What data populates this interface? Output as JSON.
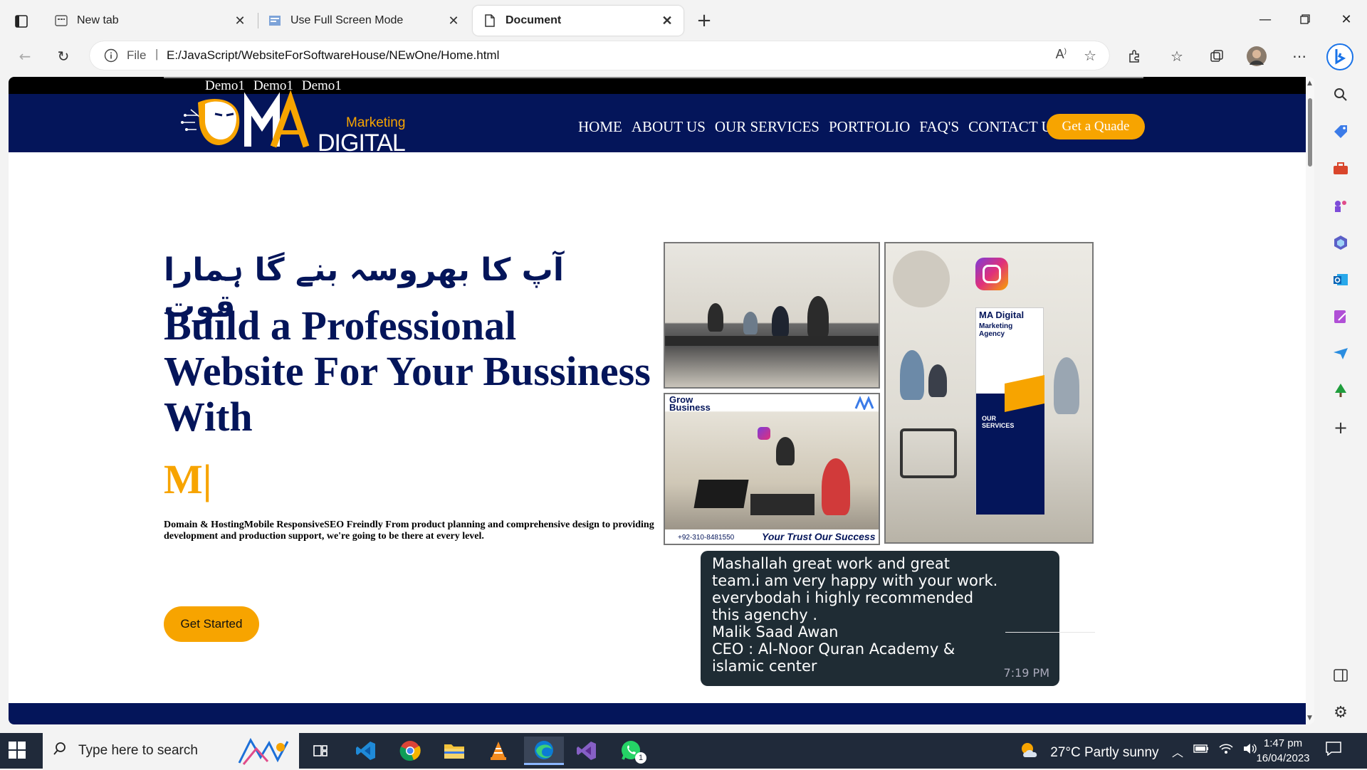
{
  "browser": {
    "tabs": [
      {
        "label": "New tab",
        "icon": "new-tab-icon"
      },
      {
        "label": "Use Full Screen Mode",
        "icon": "page-thumbnail-icon"
      },
      {
        "label": "Document",
        "icon": "document-icon",
        "active": true
      }
    ],
    "address": {
      "scheme": "File",
      "url": "E:/JavaScript/WebsiteForSoftwareHouse/NEwOne/Home.html"
    }
  },
  "site": {
    "demo_links": [
      "Demo1",
      "Demo1",
      "Demo1"
    ],
    "logo": {
      "word_top": "Marketing",
      "word_bottom": "DIGITAL"
    },
    "nav": [
      "HOME",
      "ABOUT US",
      "OUR SERVICES",
      "PORTFOLIO",
      "FAQ'S",
      "CONTACT US"
    ],
    "quote_button": "Get a Quade",
    "hero": {
      "urdu": "آپ کا بھروسہ بنے گا ہمارا قوت",
      "title_line1": "Build a Professional",
      "title_line2": "Website For Your Bussiness",
      "title_line3": "With",
      "typed": "M|",
      "description": "Domain & HostingMobile ResponsiveSEO Freindly From product planning and comprehensive design to providing development and production support, we're going to be there at every level.",
      "cta": "Get Started"
    },
    "photos": {
      "p2_brand": "MA Digital",
      "p2_sub": "Marketing Agency",
      "p2_services": "OUR SERVICES",
      "p3_header": "Grow Business",
      "p3_phone": "+92-310-8481550",
      "p3_footer": "Your Trust Our Success"
    },
    "review": {
      "lines": [
        "Mashallah great work and great",
        "team.i am very happy with your work.",
        "everybodah i highly recommended",
        "this agenchy .",
        "Malik Saad Awan",
        "CEO : Al-Noor Quran Academy &",
        "islamic center"
      ],
      "time": "7:19 PM"
    }
  },
  "taskbar": {
    "search_placeholder": "Type here to search",
    "weather": "27°C  Partly sunny",
    "time": "1:47 pm",
    "date": "16/04/2023",
    "whatsapp_badge": "1"
  },
  "colors": {
    "navy": "#04155a",
    "accent": "#f7a400"
  }
}
